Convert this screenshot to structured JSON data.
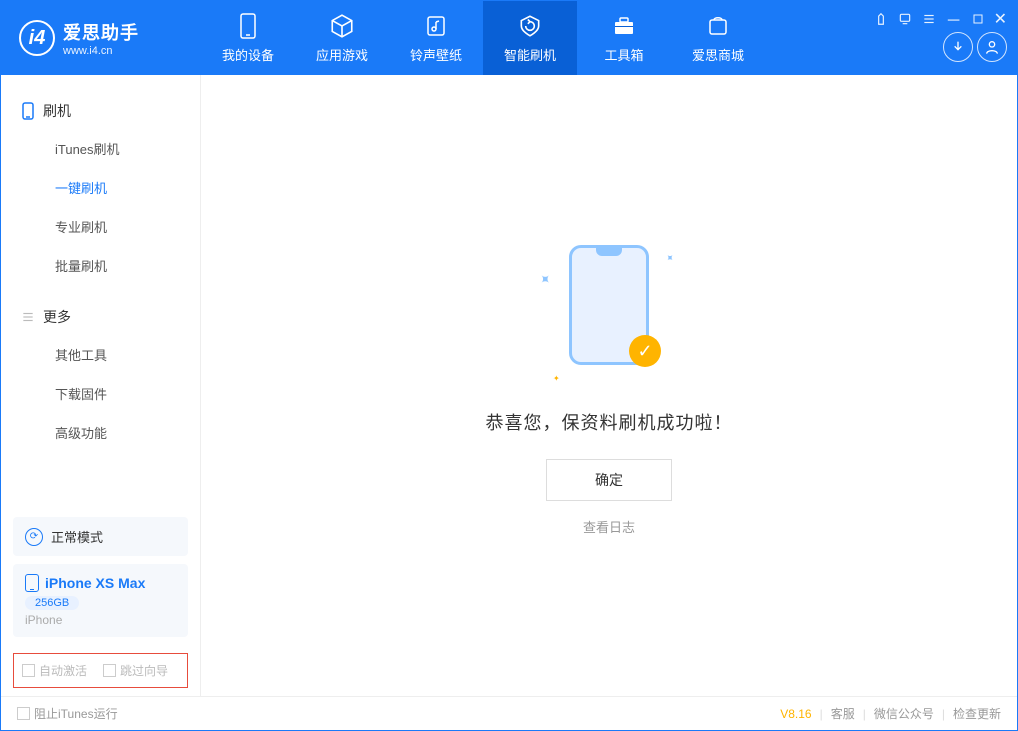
{
  "app": {
    "title": "爱思助手",
    "website": "www.i4.cn"
  },
  "nav": {
    "tabs": [
      {
        "label": "我的设备"
      },
      {
        "label": "应用游戏"
      },
      {
        "label": "铃声壁纸"
      },
      {
        "label": "智能刷机"
      },
      {
        "label": "工具箱"
      },
      {
        "label": "爱思商城"
      }
    ],
    "active_index": 3
  },
  "sidebar": {
    "section1": {
      "title": "刷机"
    },
    "items1": [
      {
        "label": "iTunes刷机"
      },
      {
        "label": "一键刷机"
      },
      {
        "label": "专业刷机"
      },
      {
        "label": "批量刷机"
      }
    ],
    "active1_index": 1,
    "section2": {
      "title": "更多"
    },
    "items2": [
      {
        "label": "其他工具"
      },
      {
        "label": "下载固件"
      },
      {
        "label": "高级功能"
      }
    ],
    "mode_label": "正常模式",
    "device": {
      "name": "iPhone XS Max",
      "capacity": "256GB",
      "type": "iPhone"
    },
    "checks": {
      "auto_activate": "自动激活",
      "skip_guide": "跳过向导"
    }
  },
  "content": {
    "status_message": "恭喜您，保资料刷机成功啦！",
    "ok_button": "确定",
    "log_link": "查看日志"
  },
  "footer": {
    "block_itunes": "阻止iTunes运行",
    "version": "V8.16",
    "support": "客服",
    "wechat": "微信公众号",
    "check_update": "检查更新"
  },
  "colors": {
    "primary": "#1a7af8",
    "accent": "#ffb400",
    "highlight_border": "#e74c3c"
  }
}
